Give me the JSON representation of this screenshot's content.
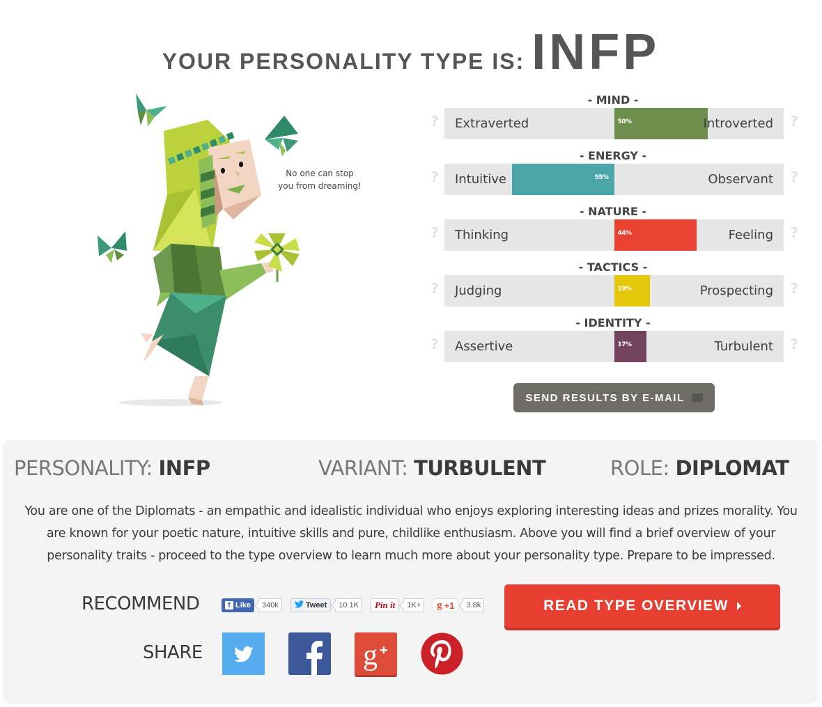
{
  "header": {
    "lead": "YOUR PERSONALITY TYPE IS:",
    "type": "INFP"
  },
  "illustration": {
    "quote": "No one can stop you from dreaming!",
    "colors": {
      "hair": "#c9dc4a",
      "skin": "#f2d3c0",
      "tunic": "#6e8f4f",
      "skirt": "#3c8d6a",
      "butterfly": "#3c9a78"
    }
  },
  "traits": [
    {
      "title": "- MIND -",
      "left": "Extraverted",
      "right": "Introverted",
      "percent": 50,
      "percent_label": "50%",
      "direction": "right",
      "color": "#6e8e4e"
    },
    {
      "title": "- ENERGY -",
      "left": "Intuitive",
      "right": "Observant",
      "percent": 55,
      "percent_label": "55%",
      "direction": "left",
      "color": "#4aa6a9"
    },
    {
      "title": "- NATURE -",
      "left": "Thinking",
      "right": "Feeling",
      "percent": 44,
      "percent_label": "44%",
      "direction": "right",
      "color": "#e84233"
    },
    {
      "title": "- TACTICS -",
      "left": "Judging",
      "right": "Prospecting",
      "percent": 19,
      "percent_label": "19%",
      "direction": "right",
      "color": "#e4c60a"
    },
    {
      "title": "- IDENTITY -",
      "left": "Assertive",
      "right": "Turbulent",
      "percent": 17,
      "percent_label": "17%",
      "direction": "right",
      "color": "#73435e"
    }
  ],
  "help_icon": "?",
  "email_button": "SEND RESULTS BY E-MAIL",
  "summary": {
    "personality_key": "PERSONALITY:",
    "personality_value": "INFP",
    "variant_key": "VARIANT:",
    "variant_value": "TURBULENT",
    "role_key": "ROLE:",
    "role_value": "DIPLOMAT"
  },
  "description": "You are one of the Diplomats - an empathic and idealistic individual who enjoys exploring interesting ideas and prizes morality. You are known for your poetic nature, intuitive skills and pure, childlike enthusiasm. Above you will find a brief overview of your personality traits - proceed to the type overview to learn much more about your personality type. Prepare to be impressed.",
  "recommend": {
    "label": "RECOMMEND",
    "buttons": [
      {
        "name": "facebook-like",
        "label": "Like",
        "count": "340k"
      },
      {
        "name": "twitter-tweet",
        "label": "Tweet",
        "count": "10.1K"
      },
      {
        "name": "pinterest-pin",
        "label": "Pin it",
        "count": "1K+"
      },
      {
        "name": "google-plus-one",
        "label": "+1",
        "count": "3.8k"
      }
    ]
  },
  "read_button": "READ TYPE OVERVIEW",
  "share": {
    "label": "SHARE",
    "icons": [
      {
        "name": "twitter",
        "color": "#55acee"
      },
      {
        "name": "facebook",
        "color": "#3b5998"
      },
      {
        "name": "google-plus",
        "color": "#dd4b39"
      },
      {
        "name": "pinterest",
        "color": "#cb2027"
      }
    ]
  }
}
